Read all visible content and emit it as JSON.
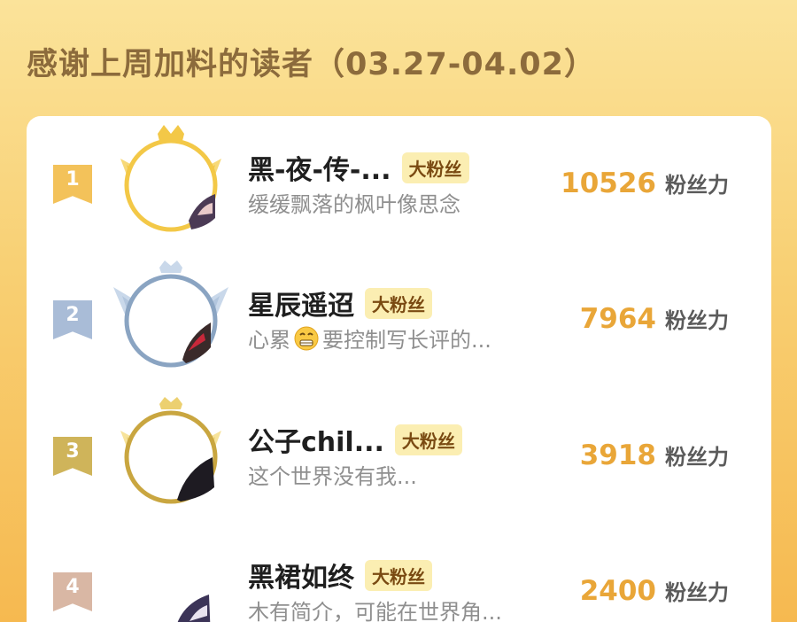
{
  "header": {
    "title": "感谢上周加料的读者（03.27-04.02）"
  },
  "readers": [
    {
      "rank": "1",
      "name": "黑-夜-传-...",
      "badge": "大粉丝",
      "bio": "缓缓飘落的枫叶像思念",
      "score": "10526",
      "score_unit": "粉丝力",
      "frame_color": "#f3c847",
      "ribbon_color": "#f3c25a"
    },
    {
      "rank": "2",
      "name": "星辰遥迢",
      "badge": "大粉丝",
      "bio_before": "心累",
      "bio_emoji": "grimacing-face-emoji",
      "bio_after": "要控制写长评的...",
      "score": "7964",
      "score_unit": "粉丝力",
      "frame_color": "#8aa4c2",
      "ribbon_color": "#a9bcd7"
    },
    {
      "rank": "3",
      "name": "公子chil...",
      "badge": "大粉丝",
      "bio": "这个世界没有我...",
      "score": "3918",
      "score_unit": "粉丝力",
      "frame_color": "#c9a640",
      "ribbon_color": "#cfb45a"
    },
    {
      "rank": "4",
      "name": "黑裙如终",
      "badge": "大粉丝",
      "bio": "木有简介，可能在世界角...",
      "score": "2400",
      "score_unit": "粉丝力",
      "frame_color": "#d9bfae",
      "ribbon_color": "#d9b7a4"
    }
  ]
}
